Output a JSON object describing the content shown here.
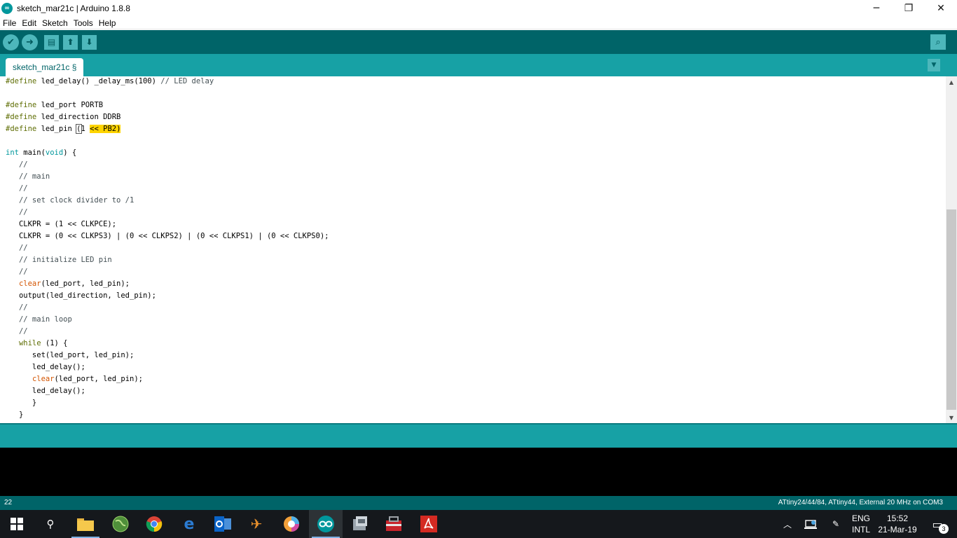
{
  "window": {
    "title": "sketch_mar21c | Arduino 1.8.8",
    "minimize": "─",
    "restore": "❐",
    "close": "✕"
  },
  "menu": [
    "File",
    "Edit",
    "Sketch",
    "Tools",
    "Help"
  ],
  "toolbar": {
    "verify_icon": "check-icon",
    "upload_icon": "arrow-right-icon",
    "new_icon": "file-icon",
    "open_icon": "arrow-up-icon",
    "save_icon": "arrow-down-icon",
    "serial_icon": "magnifier-icon"
  },
  "tab": {
    "label": "sketch_mar21c §"
  },
  "editor": {
    "lines": [
      "#define led_delay() _delay_ms(100) // LED delay",
      "",
      "#define led_port PORTB",
      "#define led_direction DDRB",
      "#define led_pin (1 << PB2)",
      "",
      "int main(void) {",
      "   //",
      "   // main",
      "   //",
      "   // set clock divider to /1",
      "   //",
      "   CLKPR = (1 << CLKPCE);",
      "   CLKPR = (0 << CLKPS3) | (0 << CLKPS2) | (0 << CLKPS1) | (0 << CLKPS0);",
      "   //",
      "   // initialize LED pin",
      "   //",
      "   clear(led_port, led_pin);",
      "   output(led_direction, led_pin);",
      "   //",
      "   // main loop",
      "   //",
      "   while (1) {",
      "      set(led_port, led_pin);",
      "      led_delay();",
      "      clear(led_port, led_pin);",
      "      led_delay();",
      "      }",
      "   }"
    ]
  },
  "status": {
    "line_number": "22",
    "board": "ATtiny24/44/84, ATtiny44, External 20 MHz on COM3"
  },
  "taskbar": {
    "apps": [
      "start",
      "search",
      "file-explorer",
      "globe-app",
      "chrome",
      "edge",
      "outlook",
      "inkscape",
      "paint-app",
      "arduino",
      "app-box",
      "toolbox-app",
      "acrobat"
    ],
    "lang_top": "ENG",
    "lang_bottom": "INTL",
    "time": "15:52",
    "date": "21-Mar-19",
    "notification_count": "3"
  }
}
